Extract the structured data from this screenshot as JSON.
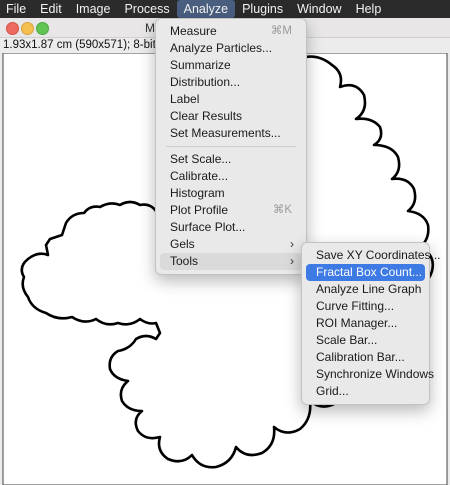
{
  "menubar": {
    "items": [
      "File",
      "Edit",
      "Image",
      "Process",
      "Analyze",
      "Plugins",
      "Window",
      "Help"
    ],
    "active": "Analyze"
  },
  "window": {
    "title": "M",
    "info": "1.93x1.87 cm (590x571); 8-bit ("
  },
  "analyze_menu": {
    "items": [
      {
        "label": "Measure",
        "shortcut": "⌘M"
      },
      {
        "label": "Analyze Particles..."
      },
      {
        "label": "Summarize"
      },
      {
        "label": "Distribution..."
      },
      {
        "label": "Label"
      },
      {
        "label": "Clear Results"
      },
      {
        "label": "Set Measurements..."
      },
      {
        "label": "Set Scale..."
      },
      {
        "label": "Calibrate..."
      },
      {
        "label": "Histogram"
      },
      {
        "label": "Plot Profile",
        "shortcut": "⌘K"
      },
      {
        "label": "Surface Plot..."
      },
      {
        "label": "Gels",
        "submenu": true
      },
      {
        "label": "Tools",
        "submenu": true
      }
    ],
    "highlighted": "Tools"
  },
  "tools_menu": {
    "items": [
      "Save XY Coordinates...",
      "Fractal Box Count...",
      "Analyze Line Graph",
      "Curve Fitting...",
      "ROI Manager...",
      "Scale Bar...",
      "Calibration Bar...",
      "Synchronize Windows",
      "Grid..."
    ],
    "selected": "Fractal Box Count..."
  },
  "icons": {
    "submenu_arrow": "chevron-right-icon",
    "window_close": "close-icon",
    "window_minimize": "minimize-icon",
    "window_zoom": "zoom-icon"
  },
  "colors": {
    "menubar_bg": "#2b2b2b",
    "selection": "#3d7ae3",
    "close_light": "#ed6a5e",
    "minimize_light": "#f5bf4f",
    "zoom_light": "#61c554"
  }
}
